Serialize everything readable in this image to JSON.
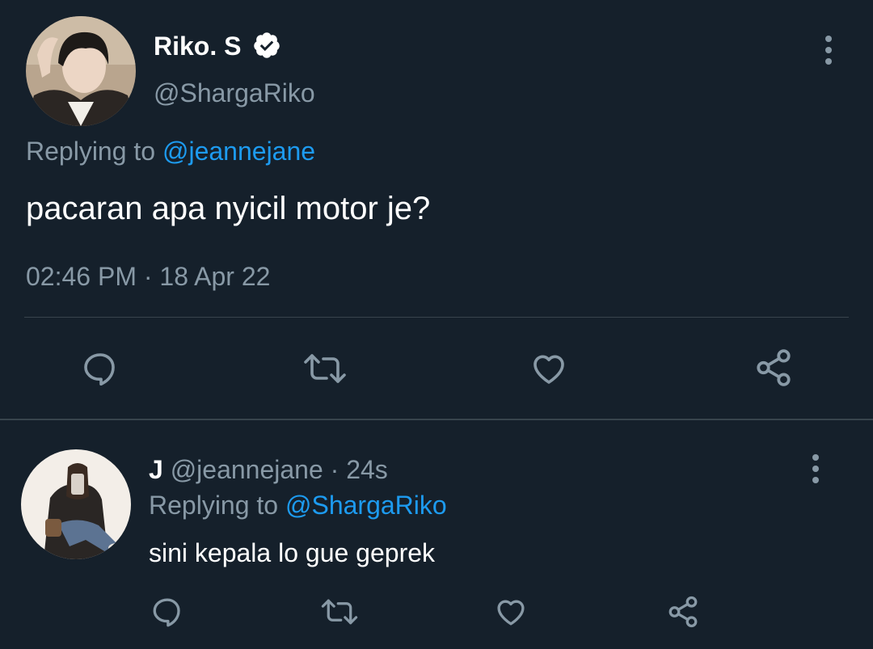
{
  "main_tweet": {
    "display_name": "Riko. S",
    "handle": "@ShargaRiko",
    "replying_prefix": "Replying to",
    "replying_to": "@jeannejane",
    "text": "pacaran apa nyicil motor je?",
    "timestamp": "02:46 PM · 18 Apr 22"
  },
  "reply_tweet": {
    "display_name": "J",
    "handle_time": "@jeannejane · 24s",
    "replying_prefix": "Replying to",
    "replying_to": "@ShargaRiko",
    "text": "sini kepala lo gue geprek"
  },
  "icons": {
    "verified": "verified-badge-icon",
    "more": "more-vertical-icon",
    "reply": "reply-icon",
    "retweet": "retweet-icon",
    "like": "like-icon",
    "share": "share-icon"
  },
  "colors": {
    "background": "#15202b",
    "text": "#ffffff",
    "muted": "#8899a6",
    "link": "#1d9bf0",
    "divider": "#38444d"
  }
}
